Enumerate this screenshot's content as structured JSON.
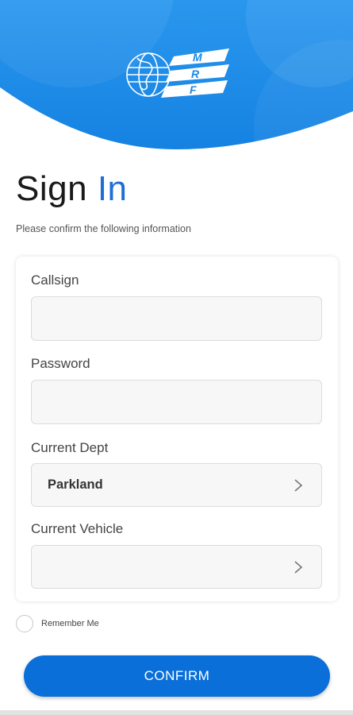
{
  "header": {
    "logo_text": "MRF",
    "colors": {
      "hero": "#1a8ae8",
      "accent": "#1e6fd6"
    }
  },
  "signin": {
    "title_main": "Sign",
    "title_accent": "In",
    "subtitle": "Please confirm the following information"
  },
  "form": {
    "callsign_label": "Callsign",
    "callsign_value": "",
    "password_label": "Password",
    "password_value": "",
    "dept_label": "Current Dept",
    "dept_value": "Parkland",
    "vehicle_label": "Current Vehicle",
    "vehicle_value": ""
  },
  "remember_label": "Remember Me",
  "confirm_label": "CONFIRM",
  "icons": {
    "dept_chevron": "chevron-right-icon",
    "vehicle_chevron": "chevron-right-icon",
    "remember": "radio-icon"
  }
}
